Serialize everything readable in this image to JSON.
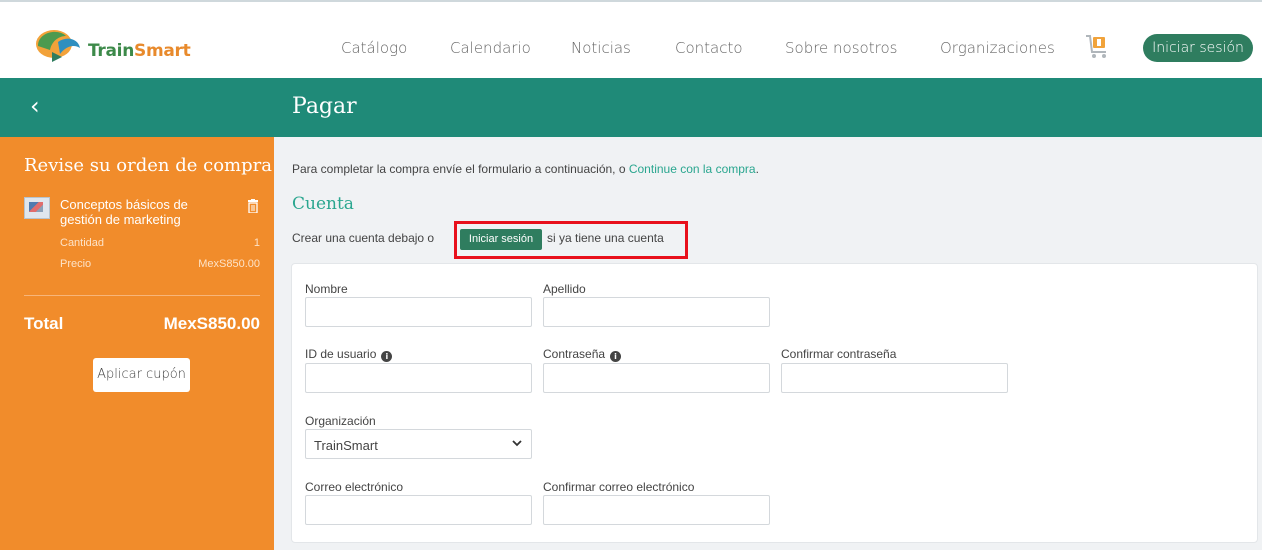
{
  "header": {
    "logo": {
      "part1": "Train",
      "part2": "Smart"
    },
    "nav": [
      {
        "label": "Catálogo"
      },
      {
        "label": "Calendario"
      },
      {
        "label": "Noticias"
      },
      {
        "label": "Contacto"
      },
      {
        "label": "Sobre nosotros"
      },
      {
        "label": "Organizaciones"
      }
    ],
    "cart_icon": "shopping-cart-icon",
    "login_label": "Iniciar sesión"
  },
  "page": {
    "title": "Pagar"
  },
  "sidebar": {
    "title": "Revise su orden de compra",
    "item": {
      "name": "Conceptos básicos de gestión de marketing",
      "quantity_label": "Cantidad",
      "quantity_value": "1",
      "price_label": "Precio",
      "price_value": "MexS850.00"
    },
    "total_label": "Total",
    "total_value": "MexS850.00",
    "coupon_label": "Aplicar cupón"
  },
  "main": {
    "intro_text": "Para completar la compra envíe el formulario a continuación, o ",
    "intro_link": "Continue con la compra",
    "intro_end": ".",
    "section_title": "Cuenta",
    "account_text": "Crear una cuenta debajo o",
    "login_button": "Iniciar sesión",
    "account_tail": "si ya tiene una cuenta",
    "form": {
      "first_name_label": "Nombre",
      "last_name_label": "Apellido",
      "user_id_label": "ID de usuario",
      "password_label": "Contraseña",
      "confirm_password_label": "Confirmar contraseña",
      "organization_label": "Organización",
      "organization_value": "TrainSmart",
      "email_label": "Correo electrónico",
      "confirm_email_label": "Confirmar correo electrónico"
    }
  },
  "colors": {
    "green_bar": "#1f8a78",
    "sidebar": "#f18c2b",
    "button": "#2f7d5f",
    "link": "#2aa68f",
    "highlight": "#e8101c"
  }
}
